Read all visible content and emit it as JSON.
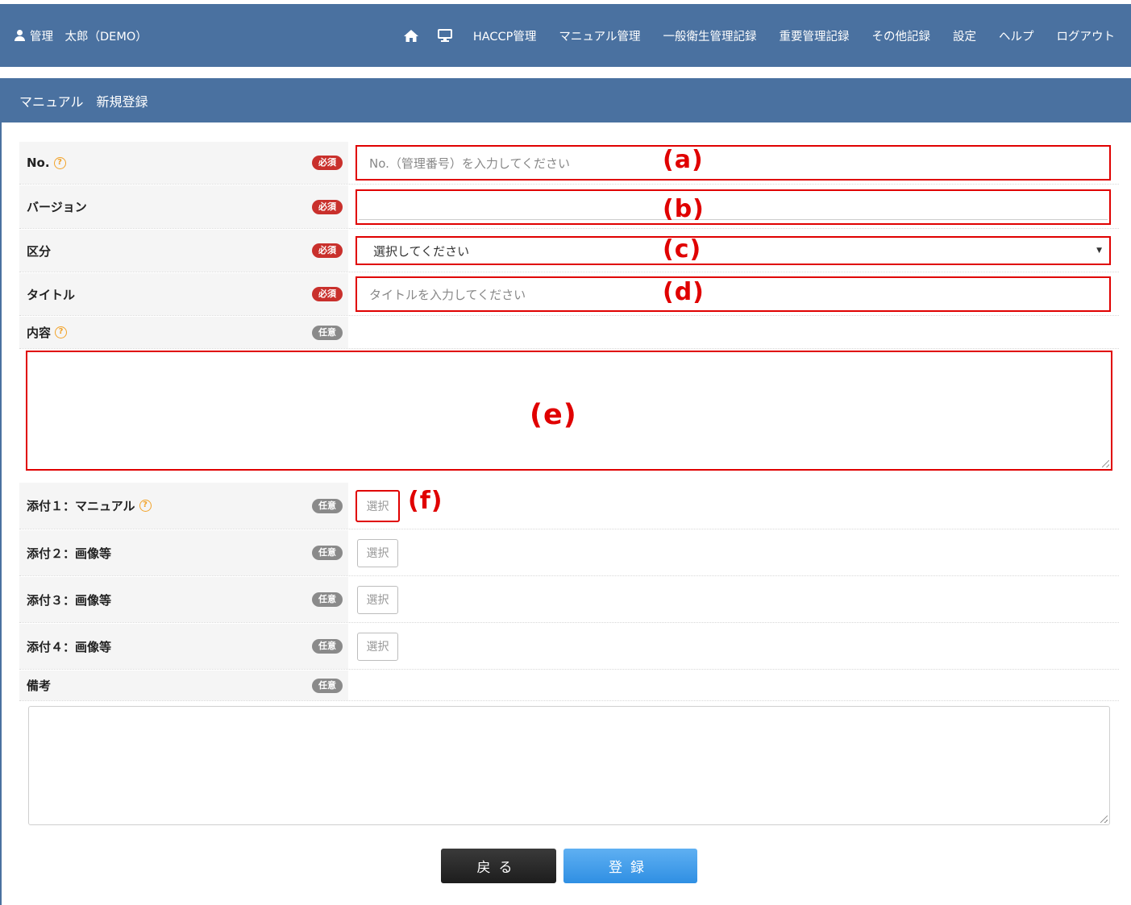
{
  "header": {
    "user": "管理　太郎（DEMO）",
    "nav": [
      "HACCP管理",
      "マニュアル管理",
      "一般衛生管理記録",
      "重要管理記録",
      "その他記録",
      "設定",
      "ヘルプ",
      "ログアウト"
    ]
  },
  "panel": {
    "title": "マニュアル　新規登録"
  },
  "badges": {
    "required": "必須",
    "optional": "任意"
  },
  "form": {
    "no": {
      "label": "No.",
      "placeholder": "No.（管理番号）を入力してください"
    },
    "version": {
      "label": "バージョン",
      "value": ""
    },
    "category": {
      "label": "区分",
      "selected": "選択してください"
    },
    "title": {
      "label": "タイトル",
      "placeholder": "タイトルを入力してください"
    },
    "content": {
      "label": "内容"
    },
    "attach1": {
      "label": "添付１：マニュアル",
      "button": "選択"
    },
    "attach2": {
      "label": "添付２：画像等",
      "button": "選択"
    },
    "attach3": {
      "label": "添付３：画像等",
      "button": "選択"
    },
    "attach4": {
      "label": "添付４：画像等",
      "button": "選択"
    },
    "remarks": {
      "label": "備考"
    }
  },
  "annotations": {
    "a": "(a)",
    "b": "(b)",
    "c": "(c)",
    "d": "(d)",
    "e": "(e)",
    "f": "(f)"
  },
  "buttons": {
    "back": "戻る",
    "register": "登録"
  },
  "colors": {
    "header": "#4a71a0",
    "highlight": "#e00000",
    "required": "#c9302c",
    "optional": "#8a8a8a",
    "register": "#2f8fe3",
    "back": "#1d1d1d",
    "help": "#f2a32a"
  }
}
